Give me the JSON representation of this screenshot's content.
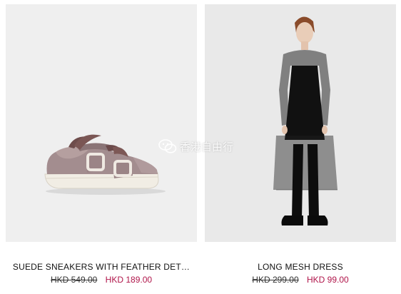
{
  "products": [
    {
      "name": "SUEDE SNEAKERS WITH FEATHER DET…",
      "old_price": "HKD 549.00",
      "new_price": "HKD 189.00"
    },
    {
      "name": "LONG MESH DRESS",
      "old_price": "HKD 299.00",
      "new_price": "HKD 99.00"
    }
  ],
  "watermark": {
    "text": "香港自由行",
    "icon": "wechat-icon"
  },
  "colors": {
    "sale_price": "#b0154a",
    "left_photo_bg": "#efefef",
    "right_photo_bg": "#e9e9e9"
  }
}
